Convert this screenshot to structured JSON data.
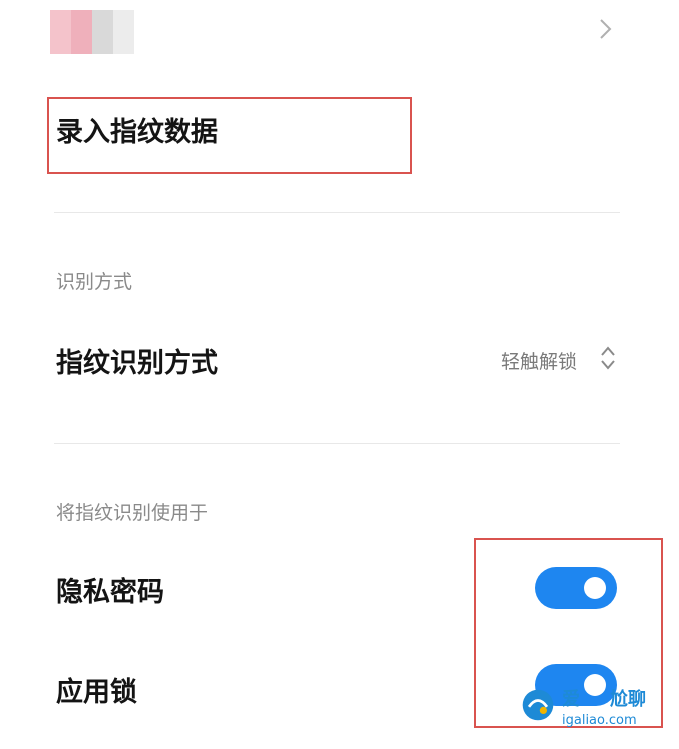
{
  "header_item": {
    "blur_colors": [
      "#f4c3cb",
      "#efb0bb",
      "#d9d9d9",
      "#ececec"
    ],
    "chevron_icon": "chevron-right-icon"
  },
  "enroll": {
    "label": "录入指纹数据"
  },
  "recognition": {
    "section_title": "识别方式",
    "method_label": "指纹识别方式",
    "method_value": "轻触解锁",
    "selector_icon": "up-down-chevron-icon"
  },
  "usage": {
    "section_title": "将指纹识别使用于",
    "items": [
      {
        "label": "隐私密码",
        "enabled": true
      },
      {
        "label": "应用锁",
        "enabled": true
      }
    ]
  },
  "colors": {
    "accent": "#1e86f0",
    "highlight": "#d9534f"
  },
  "watermark": {
    "logo": "爱",
    "name": "尬聊",
    "url": "igaliao.com"
  }
}
